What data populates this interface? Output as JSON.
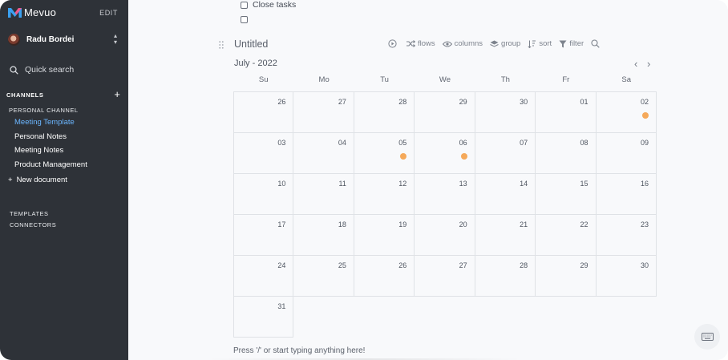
{
  "sidebar": {
    "brand": "Mevuo",
    "edit_label": "EDIT",
    "user_name": "Radu Bordei",
    "search_label": "Quick search",
    "channels_heading": "CHANNELS",
    "channel_name": "PERSONAL CHANNEL",
    "documents": [
      {
        "label": "Meeting Template",
        "active": true
      },
      {
        "label": "Personal Notes",
        "active": false
      },
      {
        "label": "Meeting Notes",
        "active": false
      },
      {
        "label": "Product Management",
        "active": false
      }
    ],
    "new_document_label": "New document",
    "templates_label": "TEMPLATES",
    "connectors_label": "CONNECTORS"
  },
  "tasks": [
    {
      "label": "Close tasks",
      "checked": false
    },
    {
      "label": "",
      "checked": false
    }
  ],
  "view": {
    "title": "Untitled",
    "toolbar": {
      "flows": "flows",
      "columns": "columns",
      "group": "group",
      "sort": "sort",
      "filter": "filter"
    }
  },
  "calendar": {
    "month_label": "July - 2022",
    "weekdays": [
      "Su",
      "Mo",
      "Tu",
      "We",
      "Th",
      "Fr",
      "Sa"
    ],
    "weeks": [
      [
        {
          "day": "26"
        },
        {
          "day": "27"
        },
        {
          "day": "28"
        },
        {
          "day": "29"
        },
        {
          "day": "30"
        },
        {
          "day": "01"
        },
        {
          "day": "02",
          "event": true
        }
      ],
      [
        {
          "day": "03"
        },
        {
          "day": "04"
        },
        {
          "day": "05",
          "event": true
        },
        {
          "day": "06",
          "event": true
        },
        {
          "day": "07"
        },
        {
          "day": "08"
        },
        {
          "day": "09"
        }
      ],
      [
        {
          "day": "10"
        },
        {
          "day": "11"
        },
        {
          "day": "12"
        },
        {
          "day": "13"
        },
        {
          "day": "14"
        },
        {
          "day": "15"
        },
        {
          "day": "16"
        }
      ],
      [
        {
          "day": "17"
        },
        {
          "day": "18"
        },
        {
          "day": "19"
        },
        {
          "day": "20"
        },
        {
          "day": "21"
        },
        {
          "day": "22"
        },
        {
          "day": "23"
        }
      ],
      [
        {
          "day": "24"
        },
        {
          "day": "25"
        },
        {
          "day": "26"
        },
        {
          "day": "27"
        },
        {
          "day": "28"
        },
        {
          "day": "29"
        },
        {
          "day": "30"
        }
      ],
      [
        {
          "day": "31"
        }
      ]
    ],
    "event_color": "#f5a95a"
  },
  "editor": {
    "prompt": "Press '/' or start typing anything here!"
  },
  "colors": {
    "sidebar_bg": "#2e3238",
    "active_link": "#6bb6ff",
    "main_bg": "#f8f9fb"
  }
}
